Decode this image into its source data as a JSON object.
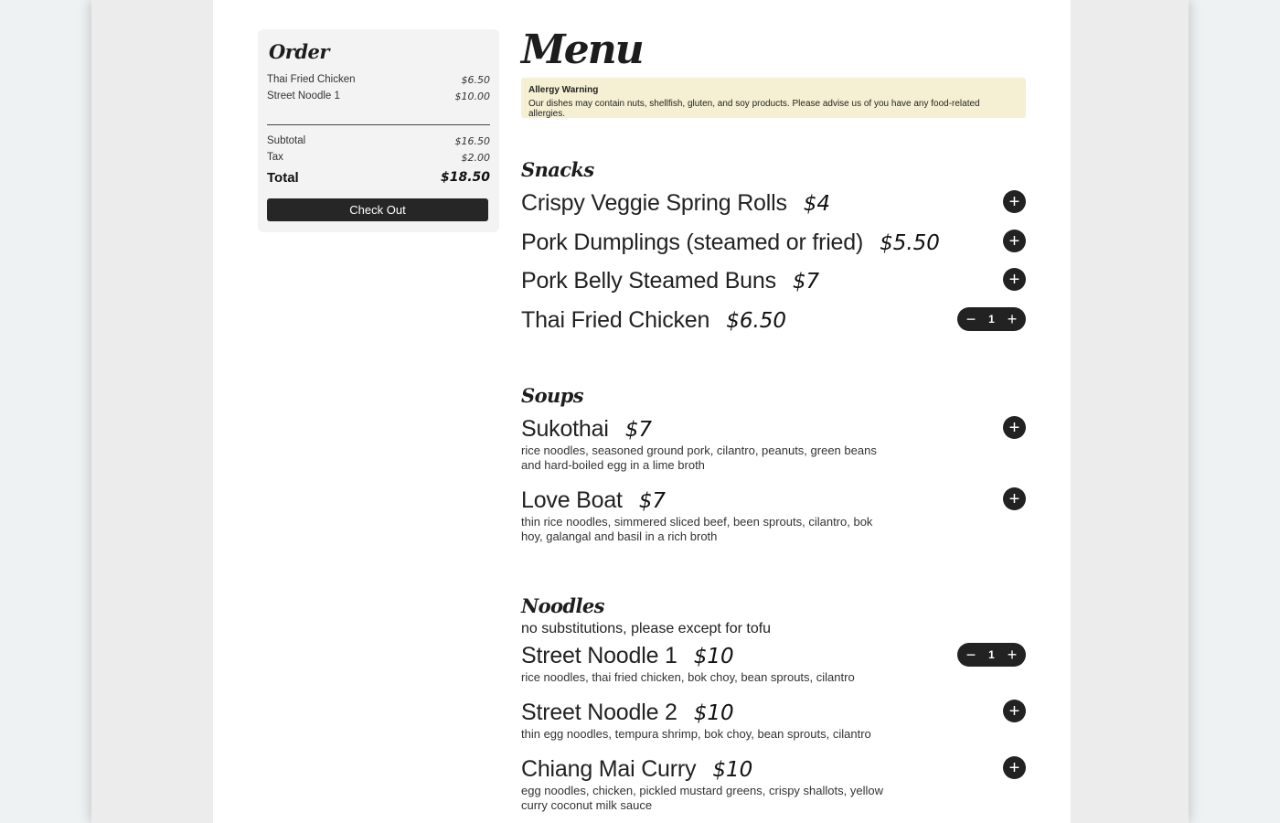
{
  "order": {
    "title": "Order",
    "items": [
      {
        "name": "Thai Fried Chicken",
        "price": "$6.50"
      },
      {
        "name": "Street Noodle 1",
        "price": "$10.00"
      }
    ],
    "subtotal_label": "Subtotal",
    "subtotal": "$16.50",
    "tax_label": "Tax",
    "tax": "$2.00",
    "total_label": "Total",
    "total": "$18.50",
    "checkout_label": "Check Out"
  },
  "menu": {
    "title": "Menu",
    "allergy": {
      "title": "Allergy Warning",
      "text": "Our dishes may contain nuts, shellfish, gluten, and soy products. Please advise us of you have any food-related allergies."
    },
    "snacks": {
      "title": "Snacks",
      "items": [
        {
          "name": "Crispy Veggie Spring Rolls",
          "price": "$4"
        },
        {
          "name": "Pork Dumplings (steamed or fried)",
          "price": "$5.50"
        },
        {
          "name": "Pork Belly Steamed Buns",
          "price": "$7"
        },
        {
          "name": "Thai Fried Chicken",
          "price": "$6.50",
          "qty": "1"
        }
      ]
    },
    "soups": {
      "title": "Soups",
      "items": [
        {
          "name": "Sukothai",
          "price": "$7",
          "desc": "rice noodles, seasoned ground pork, cilantro, peanuts, green beans and hard-boiled egg in a lime broth"
        },
        {
          "name": "Love Boat",
          "price": "$7",
          "desc": "thin rice noodles, simmered sliced beef, been sprouts, cilantro, bok hoy, galangal and basil in a rich broth"
        }
      ]
    },
    "noodles": {
      "title": "Noodles",
      "note": "no substitutions, please except for tofu",
      "items": [
        {
          "name": "Street Noodle 1",
          "price": "$10",
          "desc": "rice noodles, thai fried chicken, bok choy, bean sprouts, cilantro",
          "qty": "1"
        },
        {
          "name": "Street Noodle 2",
          "price": "$10",
          "desc": "thin egg noodles, tempura shrimp, bok choy, bean sprouts, cilantro"
        },
        {
          "name": "Chiang Mai Curry",
          "price": "$10",
          "desc": "egg noodles, chicken, pickled mustard greens, crispy shallots, yellow curry coconut milk sauce"
        }
      ]
    }
  },
  "icons": {
    "add": "plus-icon",
    "remove": "minus-icon"
  },
  "colors": {
    "accent": "#222222",
    "warning_bg": "#f5f0d3",
    "panel_bg": "#f3f3f3"
  }
}
